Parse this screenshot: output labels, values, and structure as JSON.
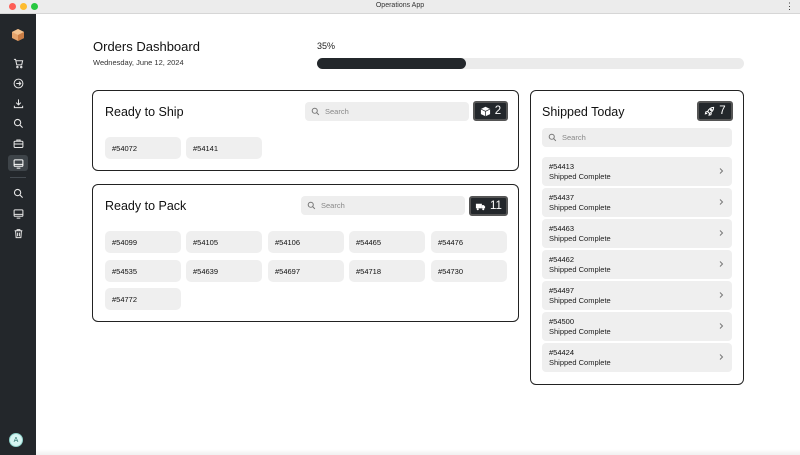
{
  "window": {
    "title": "Operations App",
    "menu_icon": "more-vertical-icon"
  },
  "sidebar": {
    "logo_icon": "box-logo-icon",
    "items": [
      {
        "icon": "cart-icon"
      },
      {
        "icon": "arrow-right-circle-icon"
      },
      {
        "icon": "download-icon"
      },
      {
        "icon": "search-icon"
      },
      {
        "icon": "briefcase-icon"
      },
      {
        "icon": "monitor-icon",
        "active": true
      },
      {
        "icon": "search-icon"
      },
      {
        "icon": "monitor-icon"
      },
      {
        "icon": "trash-icon"
      }
    ],
    "avatar_initial": "A"
  },
  "header": {
    "title": "Orders Dashboard",
    "date": "Wednesday, June 12, 2024",
    "progress_label": "35%",
    "progress_value": 0.35
  },
  "ready_to_ship": {
    "title": "Ready to Ship",
    "search_placeholder": "Search",
    "count": "2",
    "count_icon": "package-icon",
    "orders": [
      "#54072",
      "#54141"
    ]
  },
  "ready_to_pack": {
    "title": "Ready to Pack",
    "search_placeholder": "Search",
    "count": "11",
    "count_icon": "truck-icon",
    "orders": [
      "#54099",
      "#54105",
      "#54106",
      "#54465",
      "#54476",
      "#54535",
      "#54639",
      "#54697",
      "#54718",
      "#54730",
      "#54772"
    ]
  },
  "shipped_today": {
    "title": "Shipped Today",
    "search_placeholder": "Search",
    "count": "7",
    "count_icon": "rocket-icon",
    "items": [
      {
        "id": "#54413",
        "status": "Shipped Complete"
      },
      {
        "id": "#54437",
        "status": "Shipped Complete"
      },
      {
        "id": "#54463",
        "status": "Shipped Complete"
      },
      {
        "id": "#54462",
        "status": "Shipped Complete"
      },
      {
        "id": "#54497",
        "status": "Shipped Complete"
      },
      {
        "id": "#54500",
        "status": "Shipped Complete"
      },
      {
        "id": "#54424",
        "status": "Shipped Complete"
      }
    ]
  },
  "colors": {
    "dark": "#23272b",
    "chip": "#efefef",
    "search": "#eeeeee"
  }
}
